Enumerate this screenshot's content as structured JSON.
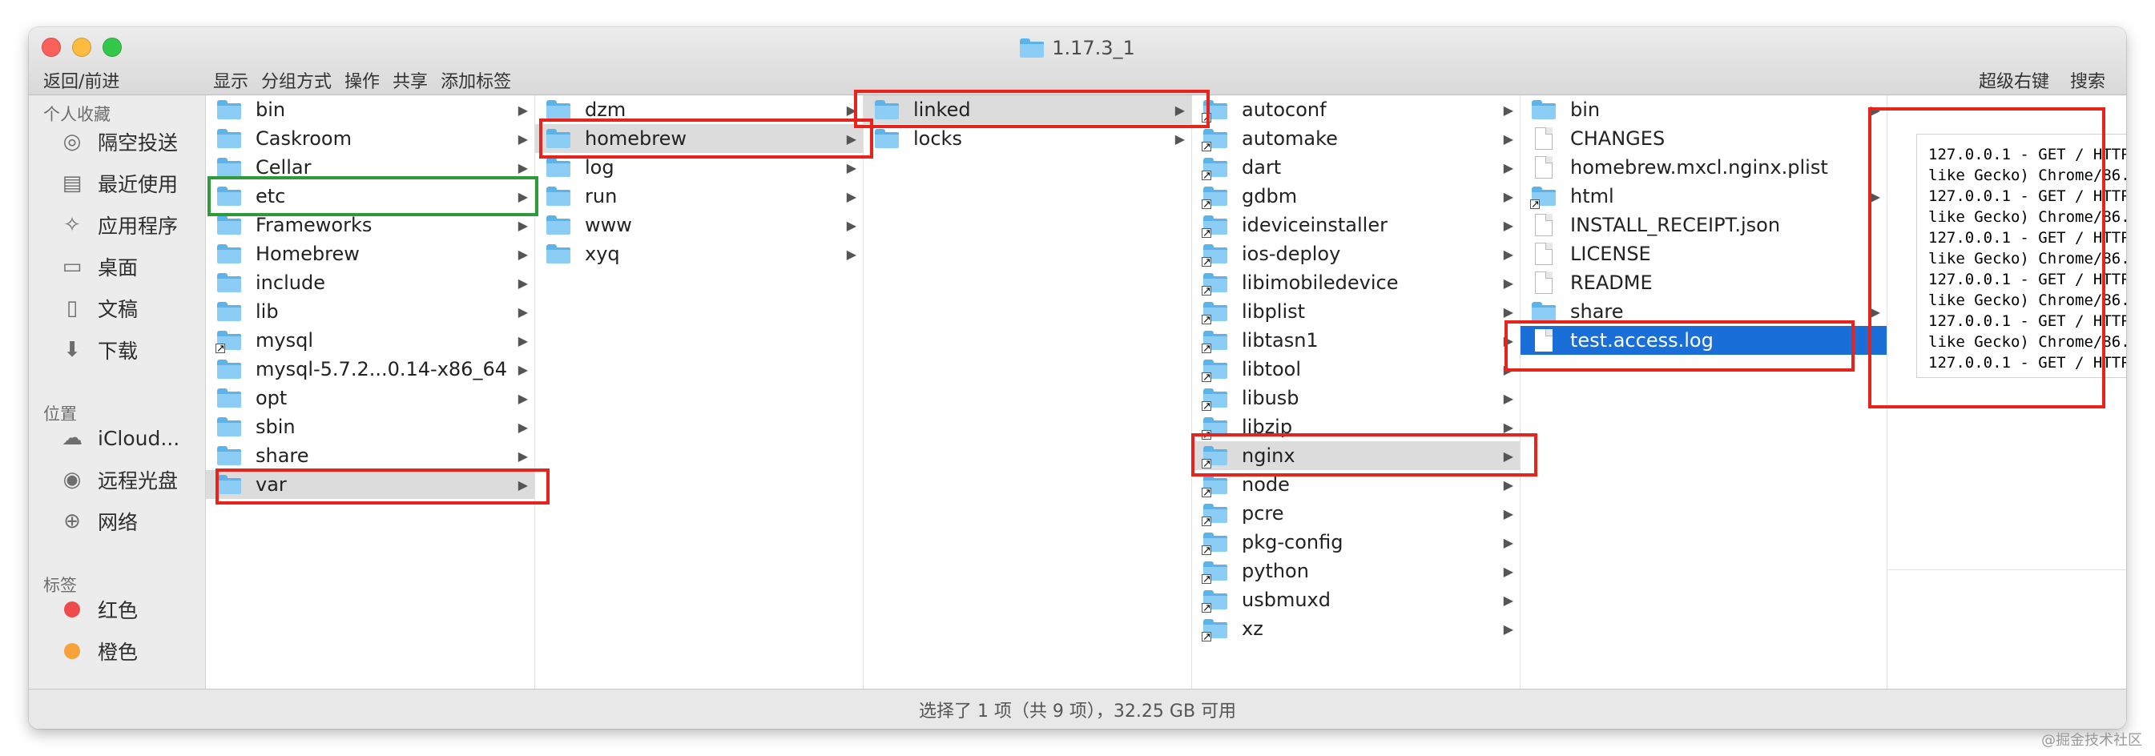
{
  "window": {
    "title": "1.17.3_1",
    "toolbar": {
      "nav_label": "返回/前进",
      "menu": [
        "显示",
        "分组方式",
        "操作",
        "共享",
        "添加标签"
      ],
      "right": [
        "超级右键",
        "搜索"
      ]
    }
  },
  "sidebar": {
    "favorites_header": "个人收藏",
    "favorites": [
      {
        "label": "隔空投送",
        "icon": "airdrop-icon"
      },
      {
        "label": "最近使用",
        "icon": "recents-icon"
      },
      {
        "label": "应用程序",
        "icon": "applications-icon"
      },
      {
        "label": "桌面",
        "icon": "desktop-icon"
      },
      {
        "label": "文稿",
        "icon": "documents-icon"
      },
      {
        "label": "下载",
        "icon": "downloads-icon"
      }
    ],
    "locations_header": "位置",
    "locations": [
      {
        "label": "iCloud...",
        "icon": "icloud-icon"
      },
      {
        "label": "远程光盘",
        "icon": "remote-disc-icon"
      },
      {
        "label": "网络",
        "icon": "network-icon"
      }
    ],
    "tags_header": "标签",
    "tags": [
      {
        "label": "红色",
        "color": "#f04b4b"
      },
      {
        "label": "橙色",
        "color": "#f7a33a"
      }
    ]
  },
  "columns": [
    {
      "name": "column-1",
      "items": [
        {
          "label": "bin",
          "type": "folder",
          "arrow": true
        },
        {
          "label": "Caskroom",
          "type": "folder",
          "arrow": true
        },
        {
          "label": "Cellar",
          "type": "folder",
          "arrow": true
        },
        {
          "label": "etc",
          "type": "folder",
          "arrow": true
        },
        {
          "label": "Frameworks",
          "type": "folder",
          "arrow": true
        },
        {
          "label": "Homebrew",
          "type": "folder",
          "arrow": true
        },
        {
          "label": "include",
          "type": "folder",
          "arrow": true
        },
        {
          "label": "lib",
          "type": "folder",
          "arrow": true
        },
        {
          "label": "mysql",
          "type": "folder",
          "alias": true,
          "arrow": true
        },
        {
          "label": "mysql-5.7.2...0.14-x86_64",
          "type": "folder",
          "arrow": true
        },
        {
          "label": "opt",
          "type": "folder",
          "arrow": true
        },
        {
          "label": "sbin",
          "type": "folder",
          "arrow": true
        },
        {
          "label": "share",
          "type": "folder",
          "arrow": true
        },
        {
          "label": "var",
          "type": "folder",
          "arrow": true,
          "selected": true
        }
      ]
    },
    {
      "name": "column-2",
      "items": [
        {
          "label": "dzm",
          "type": "folder",
          "arrow": true
        },
        {
          "label": "homebrew",
          "type": "folder",
          "arrow": true,
          "selected": true
        },
        {
          "label": "log",
          "type": "folder",
          "arrow": true
        },
        {
          "label": "run",
          "type": "folder",
          "arrow": true
        },
        {
          "label": "www",
          "type": "folder",
          "arrow": true
        },
        {
          "label": "xyq",
          "type": "folder",
          "arrow": true
        }
      ]
    },
    {
      "name": "column-3",
      "items": [
        {
          "label": "linked",
          "type": "folder",
          "arrow": true,
          "selected": true
        },
        {
          "label": "locks",
          "type": "folder",
          "arrow": true
        }
      ]
    },
    {
      "name": "column-4",
      "items": [
        {
          "label": "autoconf",
          "type": "folder",
          "alias": true,
          "arrow": true
        },
        {
          "label": "automake",
          "type": "folder",
          "alias": true,
          "arrow": true
        },
        {
          "label": "dart",
          "type": "folder",
          "alias": true,
          "arrow": true
        },
        {
          "label": "gdbm",
          "type": "folder",
          "alias": true,
          "arrow": true
        },
        {
          "label": "ideviceinstaller",
          "type": "folder",
          "alias": true,
          "arrow": true
        },
        {
          "label": "ios-deploy",
          "type": "folder",
          "alias": true,
          "arrow": true
        },
        {
          "label": "libimobiledevice",
          "type": "folder",
          "alias": true,
          "arrow": true
        },
        {
          "label": "libplist",
          "type": "folder",
          "alias": true,
          "arrow": true
        },
        {
          "label": "libtasn1",
          "type": "folder",
          "alias": true,
          "arrow": true
        },
        {
          "label": "libtool",
          "type": "folder",
          "alias": true,
          "arrow": true
        },
        {
          "label": "libusb",
          "type": "folder",
          "alias": true,
          "arrow": true
        },
        {
          "label": "libzip",
          "type": "folder",
          "alias": true,
          "arrow": true
        },
        {
          "label": "nginx",
          "type": "folder",
          "alias": true,
          "arrow": true,
          "selected": true
        },
        {
          "label": "node",
          "type": "folder",
          "alias": true,
          "arrow": true
        },
        {
          "label": "pcre",
          "type": "folder",
          "alias": true,
          "arrow": true
        },
        {
          "label": "pkg-config",
          "type": "folder",
          "alias": true,
          "arrow": true
        },
        {
          "label": "python",
          "type": "folder",
          "alias": true,
          "arrow": true
        },
        {
          "label": "usbmuxd",
          "type": "folder",
          "alias": true,
          "arrow": true
        },
        {
          "label": "xz",
          "type": "folder",
          "alias": true,
          "arrow": true
        }
      ]
    },
    {
      "name": "column-5",
      "items": [
        {
          "label": "bin",
          "type": "folder",
          "arrow": true
        },
        {
          "label": "CHANGES",
          "type": "file"
        },
        {
          "label": "homebrew.mxcl.nginx.plist",
          "type": "file"
        },
        {
          "label": "html",
          "type": "folder",
          "alias": true,
          "arrow": true
        },
        {
          "label": "INSTALL_RECEIPT.json",
          "type": "file"
        },
        {
          "label": "LICENSE",
          "type": "file"
        },
        {
          "label": "README",
          "type": "file"
        },
        {
          "label": "share",
          "type": "folder",
          "arrow": true
        },
        {
          "label": "test.access.log",
          "type": "file",
          "active": true
        }
      ]
    }
  ],
  "preview": {
    "lines": [
      "127.0.0.1 - GET / HTTP",
      "like Gecko) Chrome/86.",
      "127.0.0.1 - GET / HTTP",
      "like Gecko) Chrome/86.",
      "127.0.0.1 - GET / HTTP",
      "like Gecko) Chrome/86.",
      "127.0.0.1 - GET / HTTP",
      "like Gecko) Chrome/86.",
      "127.0.0.1 - GET / HTTP",
      "like Gecko) Chrome/86.",
      "127.0.0.1 - GET / HTTP",
      "like Gecko) Chrome/86."
    ]
  },
  "status": "选择了 1 项（共 9 项），32.25 GB 可用",
  "watermark": "@掘金技术社区"
}
